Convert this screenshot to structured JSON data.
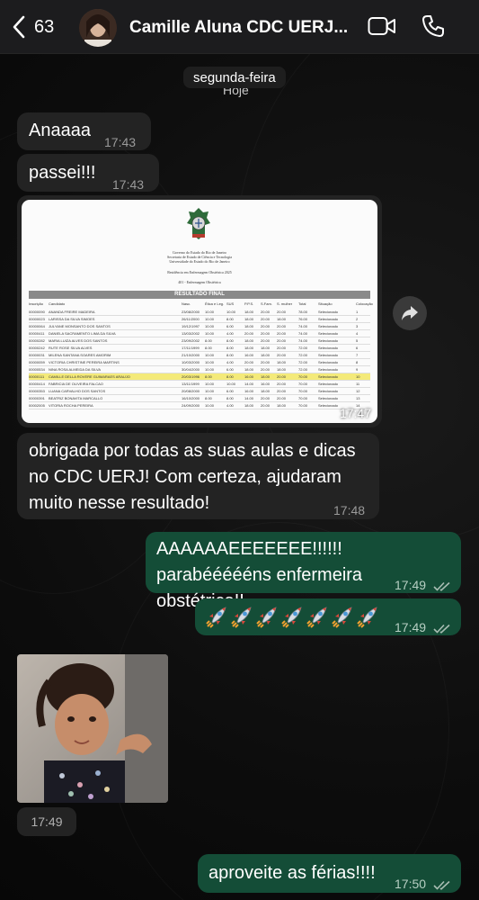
{
  "header": {
    "back_count": "63",
    "contact_name": "Camille Aluna CDC UERJ...",
    "icons": [
      "chevron-left-icon",
      "video-camera-icon",
      "phone-icon"
    ]
  },
  "date_chip": {
    "label": "segunda-feira",
    "under_label": "Hoje"
  },
  "messages": [
    {
      "direction": "in",
      "text": "Anaaaa",
      "time": "17:43"
    },
    {
      "direction": "in",
      "text": "passei!!!",
      "time": "17:43"
    },
    {
      "direction": "in",
      "type": "image",
      "time": "17:47"
    },
    {
      "direction": "in",
      "text": "obrigada por todas as suas aulas e dicas no CDC UERJ! Com certeza, ajudaram muito nesse resultado!",
      "time": "17:48"
    },
    {
      "direction": "out",
      "text": "AAAAAAEEEEEEE!!!!!! parabéééééns enfermeira obstétrica!!",
      "time": "17:49",
      "status": "read"
    },
    {
      "direction": "out",
      "text": "🚀🚀🚀🚀🚀🚀🚀",
      "time": "17:49",
      "status": "read"
    },
    {
      "direction": "in",
      "type": "photo",
      "time": "17:49"
    },
    {
      "direction": "out",
      "text": "aproveite as férias!!!!",
      "time": "17:50",
      "status": "read"
    }
  ],
  "document": {
    "header_lines": [
      "Governo do Estado do Rio de Janeiro",
      "Secretaria de Estado de Ciência e Tecnologia",
      "Universidade do Estado do Rio de Janeiro",
      "Residência em Enfermagem Obstétrica 2025",
      "401 - Enfermagem Obstétrica"
    ],
    "result_title": "RESULTADO FINAL",
    "columns": [
      "Inscrição",
      "Candidato",
      "Nasc.",
      "Ética e Leg.",
      "SUS",
      "P.P.S.",
      "S.Fam.",
      "S. mulher",
      "Total",
      "Situação",
      "Colocação"
    ],
    "rows": [
      [
        "00000090",
        "ANANDA FREIRE MADEIRA",
        "23/08/2000",
        "10.00",
        "10.00",
        "18.00",
        "20.00",
        "20.00",
        "78.00",
        "Selecionado",
        "1"
      ],
      [
        "00000023",
        "LARISSA DA SILVA SIMOES",
        "26/11/2000",
        "10.00",
        "8.00",
        "18.00",
        "20.00",
        "18.00",
        "76.00",
        "Selecionado",
        "2"
      ],
      [
        "00000064",
        "JULYANE MONSANTO DOS SANTOS",
        "19/12/1997",
        "10.00",
        "6.00",
        "18.00",
        "20.00",
        "20.00",
        "74.00",
        "Selecionado",
        "3"
      ],
      [
        "00000411",
        "DANIELA SACRAMENTO LIMA DA SILVA",
        "13/03/2002",
        "10.00",
        "4.00",
        "20.00",
        "20.00",
        "20.00",
        "74.00",
        "Selecionado",
        "4"
      ],
      [
        "00000282",
        "MARIA LUIZA ALVES DOS SANTOS",
        "23/09/2002",
        "8.00",
        "8.00",
        "18.00",
        "20.00",
        "20.00",
        "74.00",
        "Selecionado",
        "5"
      ],
      [
        "00000242",
        "RUTE ROSE SILVA ALVES",
        "17/11/1999",
        "8.00",
        "8.00",
        "18.00",
        "18.00",
        "20.00",
        "72.00",
        "Selecionado",
        "6"
      ],
      [
        "00000031",
        "MILENA SANTANA SOARES AMORIM",
        "21/10/2000",
        "10.00",
        "8.00",
        "16.00",
        "18.00",
        "20.00",
        "72.00",
        "Selecionado",
        "7"
      ],
      [
        "00000059",
        "VICTORIA CHRISTINE PEREIRA MARTINS",
        "10/03/2000",
        "10.00",
        "4.00",
        "20.00",
        "20.00",
        "18.00",
        "72.00",
        "Selecionado",
        "8"
      ],
      [
        "00000534",
        "NINA ROSA ALMEIDA DA SILVA",
        "30/04/2000",
        "10.00",
        "6.00",
        "18.00",
        "20.00",
        "18.00",
        "72.00",
        "Selecionado",
        "9"
      ],
      [
        "00000111",
        "CAMILLE DELLA ROVERE GUIMARAES ARAUJO",
        "20/03/1996",
        "8.00",
        "8.00",
        "16.00",
        "18.00",
        "20.00",
        "70.00",
        "Selecionado",
        "10"
      ],
      [
        "00000414",
        "FABRICIA DE OLIVEIRA FALCAO",
        "13/11/1999",
        "10.00",
        "10.00",
        "14.00",
        "16.00",
        "20.00",
        "70.00",
        "Selecionado",
        "11"
      ],
      [
        "00000353",
        "LUANA CARVALHO DOS SANTOS",
        "20/08/2000",
        "10.00",
        "6.00",
        "16.00",
        "18.00",
        "20.00",
        "70.00",
        "Selecionado",
        "12"
      ],
      [
        "00000391",
        "BEATRIZ BONAVITA MARCALLO",
        "16/10/2000",
        "8.00",
        "8.00",
        "14.00",
        "20.00",
        "20.00",
        "70.00",
        "Selecionado",
        "13"
      ],
      [
        "00002005",
        "VITORIA ROCHA PEREIRA",
        "24/09/2000",
        "10.00",
        "4.00",
        "18.00",
        "20.00",
        "18.00",
        "70.00",
        "Selecionado",
        "14"
      ]
    ],
    "highlighted_row": 9
  }
}
